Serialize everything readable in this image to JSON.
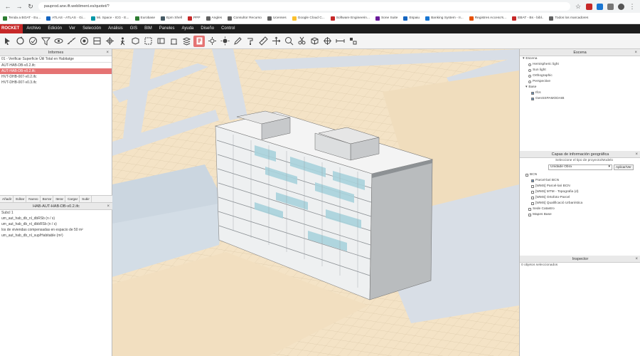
{
  "browser": {
    "url": "pauprod.ane.ift.webliment.es/quotet/?",
    "bookmarks": [
      {
        "label": "Tenda a BOAT - Eu...",
        "color": "#2e7d32"
      },
      {
        "label": "ATLAS - ATLAS · Gi...",
        "color": "#1565c0"
      },
      {
        "label": "Mi. Space - ICG - E...",
        "color": "#0097a7"
      },
      {
        "label": "Eurobase",
        "color": "#2e7d32"
      },
      {
        "label": "Epm Shell",
        "color": "#455a64"
      },
      {
        "label": "PPP",
        "color": "#c62828"
      },
      {
        "label": "Angles",
        "color": "#616161"
      },
      {
        "label": "Consultor Recurso",
        "color": "#616161"
      },
      {
        "label": "Ucenses",
        "color": "#616161"
      },
      {
        "label": "Google Cloud C...",
        "color": "#fbc02d"
      },
      {
        "label": "Software Engineerin...",
        "color": "#c62828"
      },
      {
        "label": "Sone Suite",
        "color": "#6a1b9a"
      },
      {
        "label": "Espaiu",
        "color": "#1565c0"
      },
      {
        "label": "Banking System - II...",
        "color": "#1976d2"
      },
      {
        "label": "Registres Acceso's...",
        "color": "#e65100"
      },
      {
        "label": "EBAT - Bs - bibl..",
        "color": "#c62828"
      },
      {
        "label": "Todos los marcadores",
        "color": "#616161"
      }
    ]
  },
  "menubar": {
    "brand": "ROCKET",
    "items": [
      "Archivo",
      "Edición",
      "Ver",
      "Selección",
      "Análisis",
      "GIS",
      "BIM",
      "Paneles",
      "Ayuda",
      "Diseño",
      "Control"
    ]
  },
  "toolbar": {
    "tools": [
      "select-tool",
      "rotate-tool",
      "check-tool",
      "filter-tool",
      "hide-tool",
      "measure-tool",
      "point-tool",
      "section-tool",
      "navigate-tool",
      "walk-tool",
      "box-tool",
      "clip-tool",
      "plan-tool",
      "elevation-tool",
      "layer-tool",
      "report-tool",
      "settings-tool",
      "sun-tool",
      "pencil-tool",
      "paint-tool",
      "ruler-tool",
      "move-tool",
      "zoom-tool",
      "cut-tool",
      "cube-tool",
      "crosshair-tool",
      "distance-tool",
      "snap-tool"
    ],
    "active_index": 15
  },
  "left_panel": {
    "title": "Informes",
    "report": "01 - Verificar Superficie Útil Total en Habitatge",
    "files": [
      "AUT-HAB-DB-v0.2.ifc",
      "AUT-HAB-DB-v0.2.ifc",
      "HVT-DHB-007-v0.2.ifc",
      "HVT-DHB-007-v0.3.ifc"
    ],
    "selected_file": 1,
    "buttons": [
      "Añadir",
      "Editar",
      "Nuevo",
      "Borrar",
      "Iterar",
      "Cargar",
      "Subir"
    ],
    "sub_title": "HAB-AUT-HAB-DB-v0.2.ifc",
    "sub_rows": [
      "Subcl 1",
      "um_aut_hab_db_nl_dbRSb (n / s)",
      "um_aut_hab_db_nl_dbbRSb (n / s)",
      "los de viviendas compensadas en espacio de 50 m²",
      "um_aut_hab_db_nl_sup/Habitable (m²)"
    ]
  },
  "right_panel": {
    "scene_title": "Escena",
    "scene_items": [
      {
        "label": "Escena",
        "kind": "folder"
      },
      {
        "label": "Hemispheric light",
        "kind": "dot"
      },
      {
        "label": "Sun light",
        "kind": "dot"
      },
      {
        "label": "Orthographic",
        "kind": "dot"
      },
      {
        "label": "Perspective",
        "kind": "dot"
      },
      {
        "label": "Base",
        "kind": "folder"
      },
      {
        "label": "Ifcs",
        "kind": "box"
      },
      {
        "label": "GenSSPAMODAIB",
        "kind": "box"
      }
    ],
    "layers_title": "Capas de información geográfica",
    "layers_hint": "Seleccione el tipo de proyecto/Modelo",
    "layers_select": "Unidade Obra",
    "layers_apply": "Aplicar/Ver",
    "layer_items": [
      {
        "label": "BCN",
        "checked": false
      },
      {
        "label": "Parcel-lari BCN",
        "checked": true
      },
      {
        "label": "[WMS] Parcel-lari BCN",
        "checked": false
      },
      {
        "label": "[WMS] MTM - Topografia (d)",
        "checked": false
      },
      {
        "label": "[WMS] Ortofoto-Parcel",
        "checked": false
      },
      {
        "label": "[WMS] Qualificació Urbanística",
        "checked": false
      },
      {
        "label": "Sede Catastro",
        "checked": false
      },
      {
        "label": "Mapes Base",
        "checked": false
      }
    ],
    "inspector_title": "Inspector",
    "inspector_text": "0 objetos seleccionados"
  },
  "viewport": {
    "ground_color": "#f4e3c6",
    "road_color": "#d8dee6",
    "river_color": "#cbd6e0"
  }
}
